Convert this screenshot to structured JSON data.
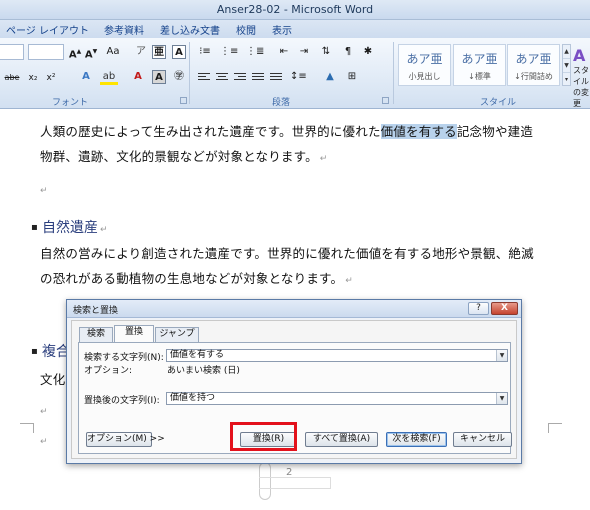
{
  "window": {
    "title": "Anser28-02 - Microsoft Word"
  },
  "ribbon": {
    "tabs": [
      "ページ レイアウト",
      "参考資料",
      "差し込み文書",
      "校閲",
      "表示"
    ],
    "groups": {
      "font": "フォント",
      "paragraph": "段落",
      "styles": "スタイル"
    },
    "styles": [
      {
        "sample": "あア亜",
        "name": "小見出し"
      },
      {
        "sample": "あア亜",
        "name": "↓標準"
      },
      {
        "sample": "あア亜",
        "name": "↓行間詰め"
      }
    ],
    "style_change_label": "スタイルの変更"
  },
  "document": {
    "para1_line1_before": "人類の歴史によって生み出された遺産です。世界的に優れた",
    "para1_line1_highlight": "価値を有する",
    "para1_line1_after": "記念物や建造",
    "para1_line2": "物群、遺跡、文化的景観などが対象となります。",
    "heading2": "自然遺産",
    "para2_line1": "自然の営みにより創造された遺産です。世界的に優れた価値を有する地形や景観、絶滅",
    "para2_line2": "の恐れがある動植物の生息地などが対象となります。",
    "heading3_partial": "複合",
    "para3_partial": "文化",
    "para_mark": "↵",
    "page_number": "2"
  },
  "dialog": {
    "title": "検索と置換",
    "help": "?",
    "close": "X",
    "tabs": [
      "検索",
      "置換",
      "ジャンプ"
    ],
    "active_tab": "置換",
    "find_label": "検索する文字列(N):",
    "find_value": "価値を有する",
    "options_label": "オプション:",
    "options_value": "あいまい検索 (日)",
    "replace_label": "置換後の文字列(I):",
    "replace_value": "価値を持つ",
    "buttons": {
      "options": "オプション(M) >>",
      "replace": "置換(R)",
      "replace_all": "すべて置換(A)",
      "find_next": "次を検索(F)",
      "cancel": "キャンセル"
    },
    "highlight_color": "#e3111b"
  }
}
